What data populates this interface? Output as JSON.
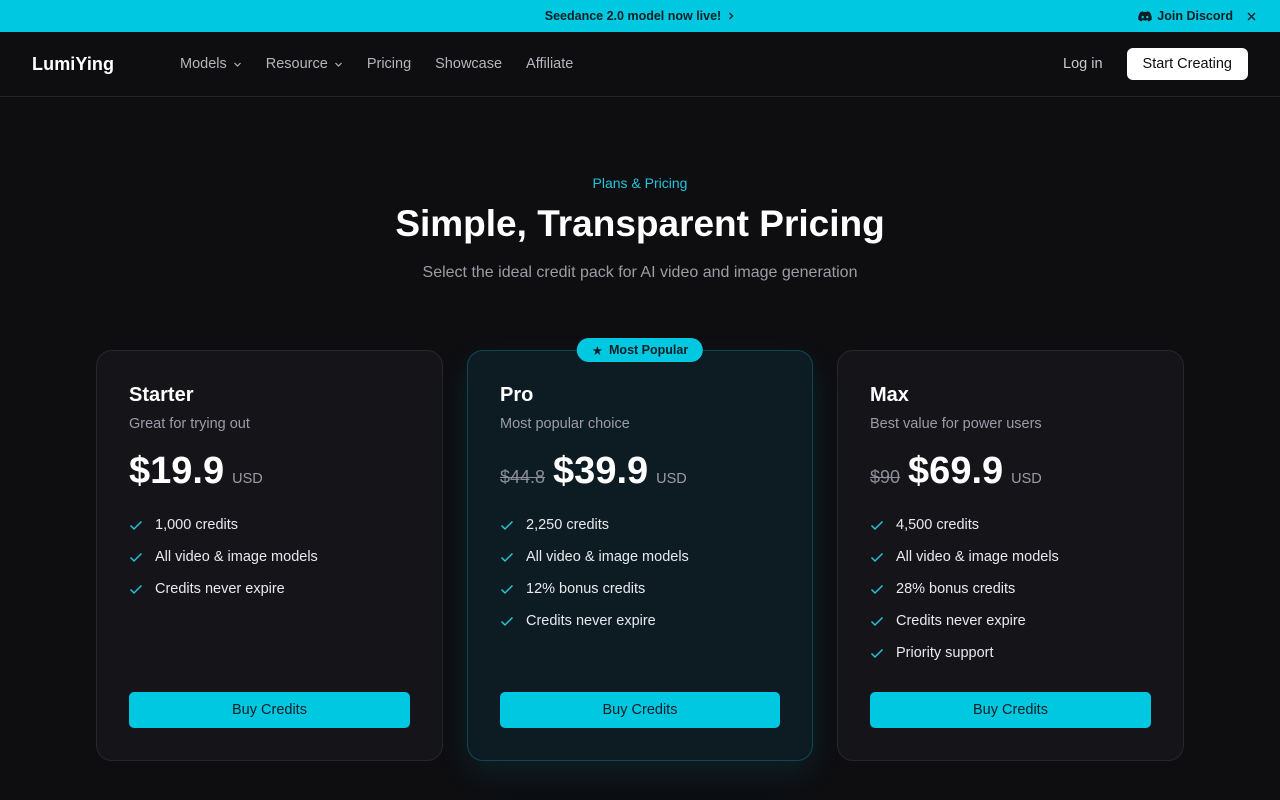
{
  "announcement": {
    "text": "Seedance 2.0 model now live!",
    "discord_label": "Join Discord"
  },
  "nav": {
    "logo": "LumiYing",
    "items": [
      {
        "label": "Models",
        "dropdown": true
      },
      {
        "label": "Resource",
        "dropdown": true
      },
      {
        "label": "Pricing",
        "dropdown": false
      },
      {
        "label": "Showcase",
        "dropdown": false
      },
      {
        "label": "Affiliate",
        "dropdown": false
      }
    ],
    "login": "Log in",
    "cta": "Start Creating"
  },
  "hero": {
    "eyebrow": "Plans & Pricing",
    "title": "Simple, Transparent Pricing",
    "subtitle": "Select the ideal credit pack for AI video and image generation"
  },
  "plans": [
    {
      "name": "Starter",
      "description": "Great for trying out",
      "old_price": "",
      "price": "$19.9",
      "currency": "USD",
      "features": [
        "1,000 credits",
        "All video & image models",
        "Credits never expire"
      ],
      "button": "Buy Credits"
    },
    {
      "name": "Pro",
      "badge": "Most Popular",
      "description": "Most popular choice",
      "old_price": "$44.8",
      "price": "$39.9",
      "currency": "USD",
      "features": [
        "2,250 credits",
        "All video & image models",
        "12% bonus credits",
        "Credits never expire"
      ],
      "button": "Buy Credits"
    },
    {
      "name": "Max",
      "description": "Best value for power users",
      "old_price": "$90",
      "price": "$69.9",
      "currency": "USD",
      "features": [
        "4,500 credits",
        "All video & image models",
        "28% bonus credits",
        "Credits never expire",
        "Priority support"
      ],
      "button": "Buy Credits"
    }
  ],
  "colors": {
    "accent": "#00c8e0",
    "background": "#0e0e11",
    "card": "#141419",
    "card_featured": "#0c1c22"
  }
}
